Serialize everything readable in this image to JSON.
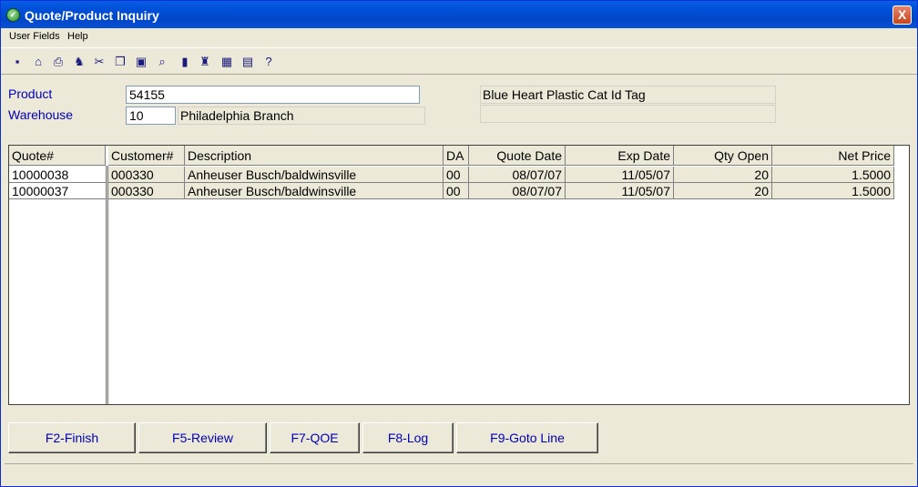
{
  "window": {
    "title": "Quote/Product Inquiry",
    "close": "X"
  },
  "menu": [
    "User Fields",
    "Help"
  ],
  "toolbar_icons": [
    "save-icon",
    "basket-icon",
    "printer-icon",
    "runner-icon",
    "scissors-icon",
    "copy-icon",
    "paste-icon",
    "magnifier-icon",
    "door-icon",
    "building-icon",
    "calculator-icon",
    "calendar-icon",
    "help-icon"
  ],
  "form": {
    "product_label": "Product",
    "product_value": "54155",
    "warehouse_label": "Warehouse",
    "warehouse_value": "10",
    "warehouse_name": "Philadelphia Branch",
    "description": "Blue Heart Plastic Cat Id Tag",
    "description2": ""
  },
  "grid": {
    "headers": [
      "Quote#",
      "Customer#",
      "Description",
      "DA",
      "Quote Date",
      "Exp Date",
      "Qty Open",
      "Net Price"
    ],
    "rows": [
      [
        "10000038",
        "000330",
        "Anheuser Busch/baldwinsville",
        "00",
        "08/07/07",
        "11/05/07",
        "20",
        "1.5000"
      ],
      [
        "10000037",
        "000330",
        "Anheuser Busch/baldwinsville",
        "00",
        "08/07/07",
        "11/05/07",
        "20",
        "1.5000"
      ]
    ]
  },
  "buttons": [
    "F2-Finish",
    "F5-Review",
    "F7-QOE",
    "F8-Log",
    "F9-Goto Line"
  ]
}
